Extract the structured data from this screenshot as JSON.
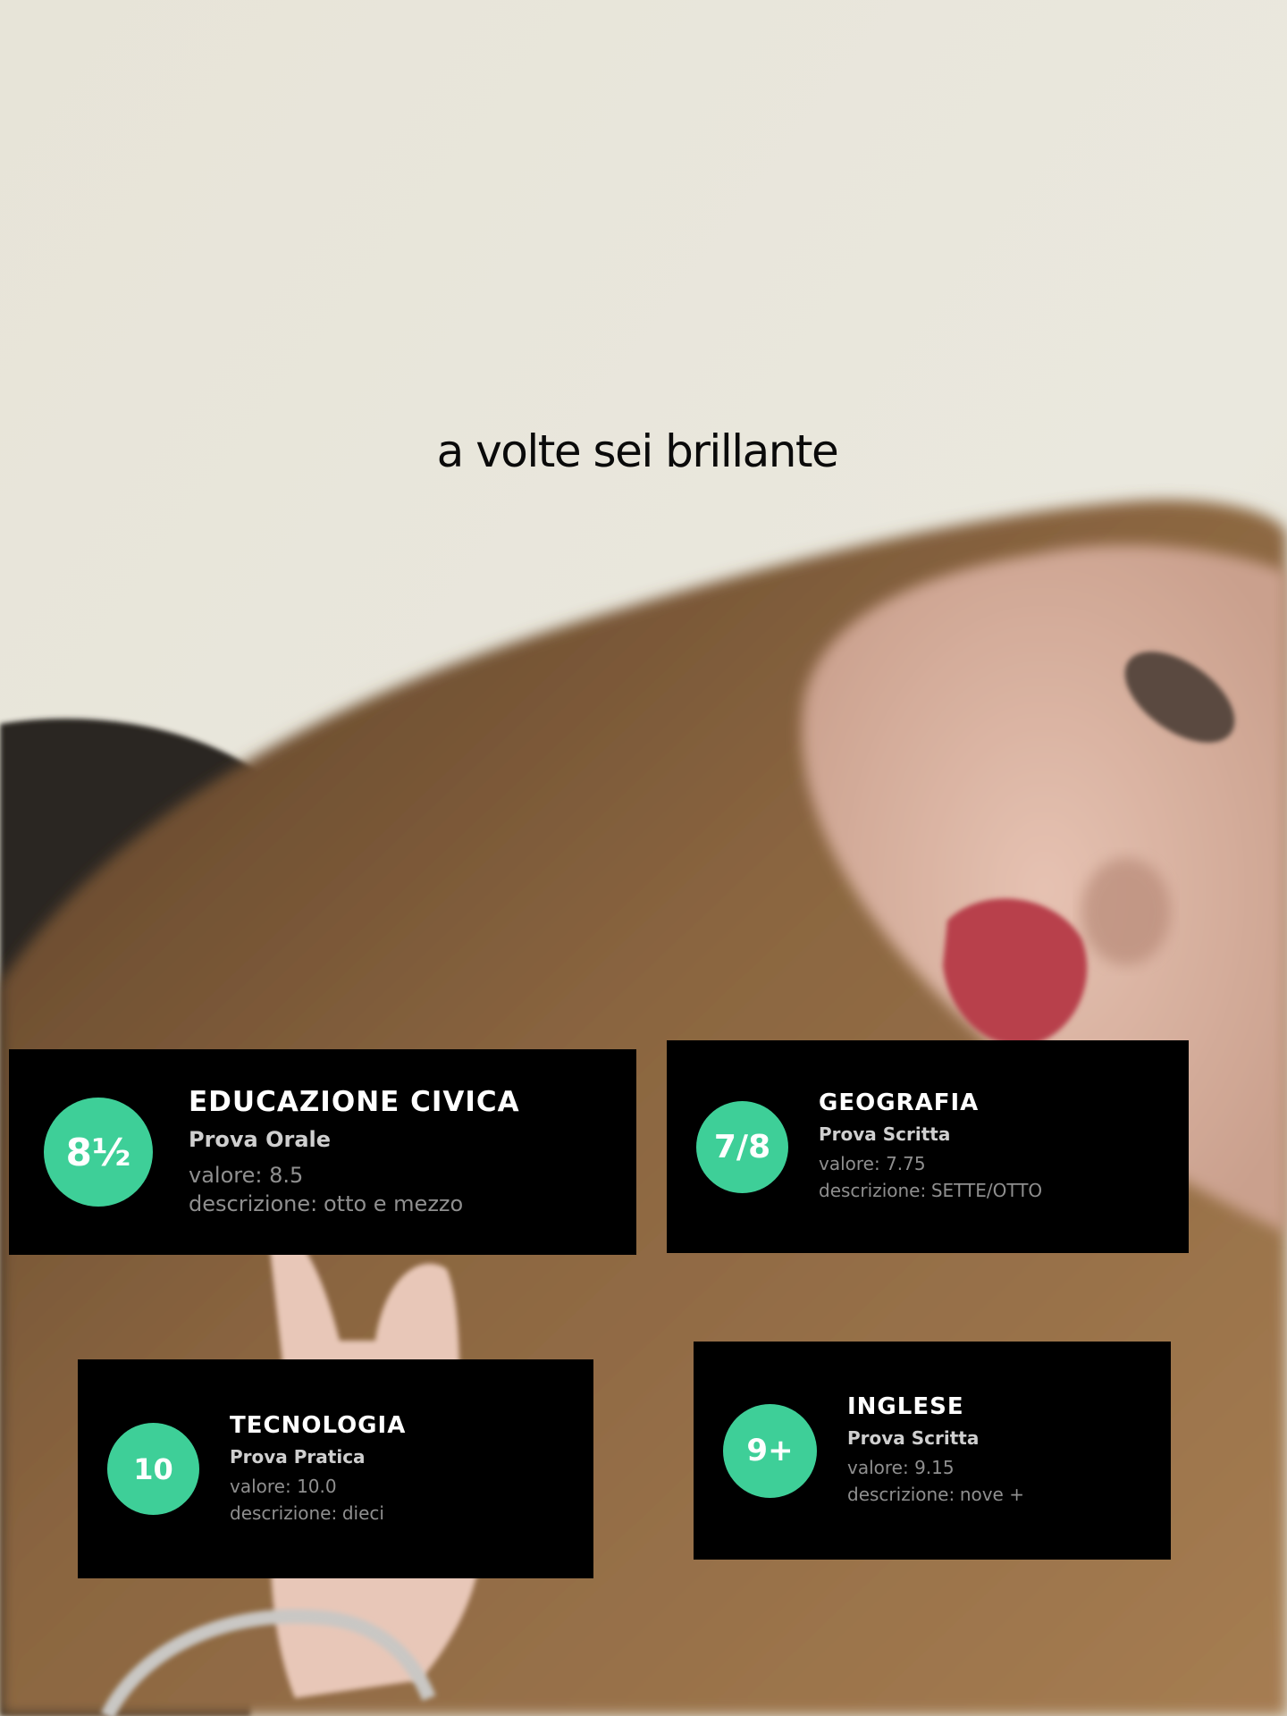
{
  "caption": "a volte sei brillante",
  "accent_color": "#3ecf98",
  "cards": [
    {
      "grade": "8½",
      "subject": "EDUCAZIONE CIVICA",
      "test_type": "Prova Orale",
      "value_text": "valore: 8.5",
      "description_label": "descrizione:",
      "description": "otto e mezzo"
    },
    {
      "grade": "7/8",
      "subject": "GEOGRAFIA",
      "test_type": "Prova Scritta",
      "value_text": "valore: 7.75",
      "description_label": "descrizione:",
      "description": "SETTE/OTTO"
    },
    {
      "grade": "10",
      "subject": "TECNOLOGIA",
      "test_type": "Prova Pratica",
      "value_text": "valore: 10.0",
      "description_label": "descrizione:",
      "description": "dieci"
    },
    {
      "grade": "9+",
      "subject": "INGLESE",
      "test_type": "Prova Scritta",
      "value_text": "valore: 9.15",
      "description_label": "descrizione:",
      "description": "nove +"
    }
  ]
}
